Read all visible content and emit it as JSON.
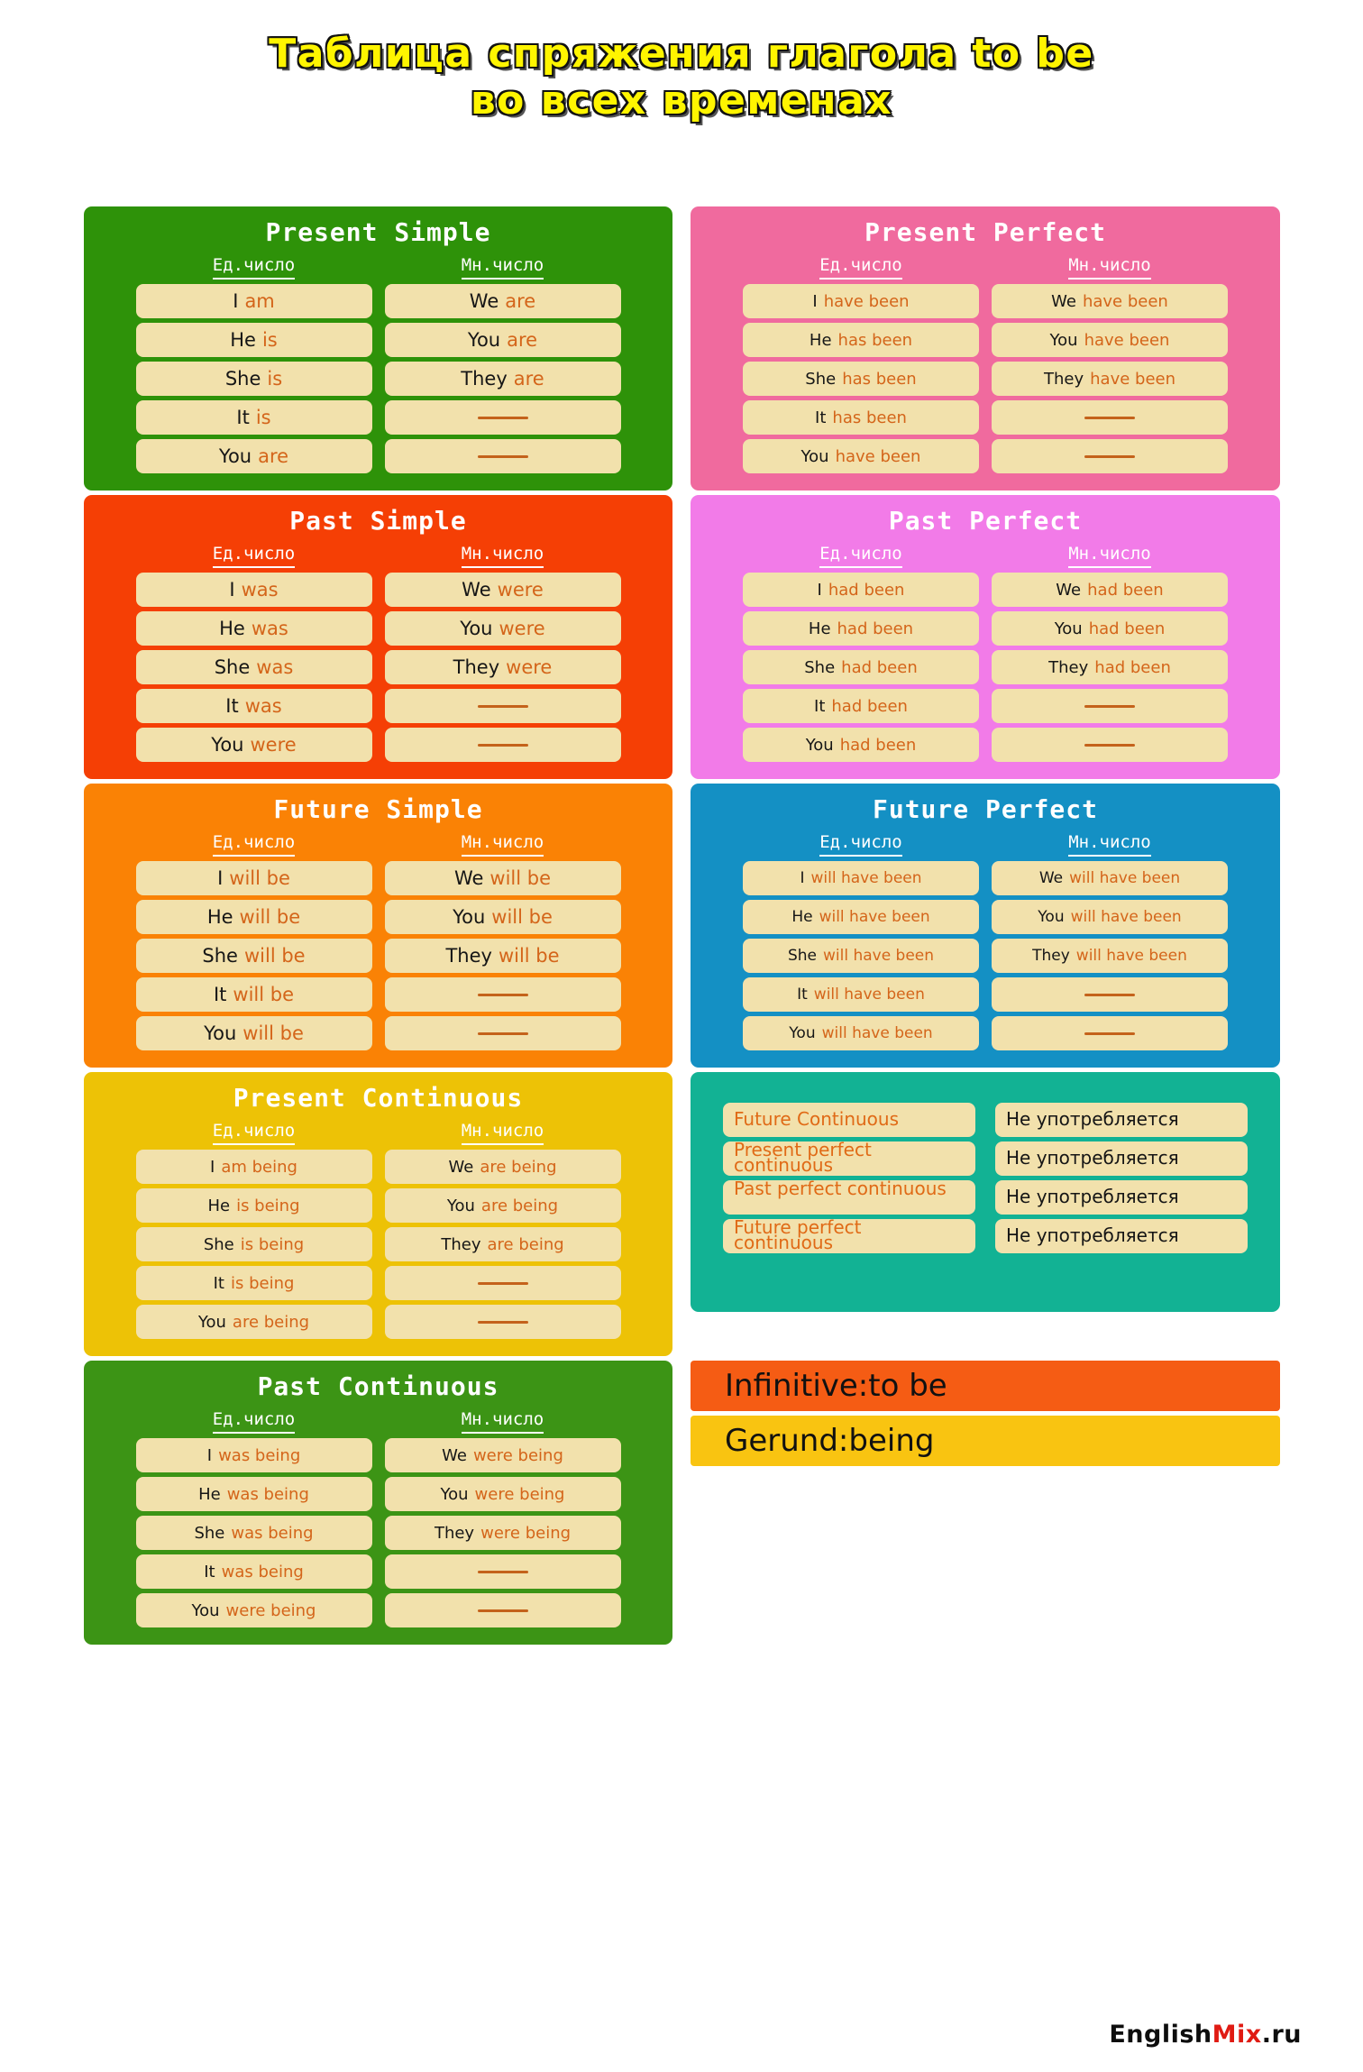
{
  "title": {
    "line1": "Таблица спряжения глагола to be",
    "line2": "во всех временах"
  },
  "labels": {
    "singular": "Ед.число",
    "plural": "Мн.число",
    "dash": "—"
  },
  "colors": {
    "present_simple": "#2E9209",
    "present_perfect": "#F06A9E",
    "past_simple": "#F53F05",
    "past_perfect": "#F27BE8",
    "future_simple": "#FA8205",
    "future_perfect": "#1490C4",
    "present_continuous": "#EDC206",
    "not_used": "#12B294",
    "past_continuous": "#3C9415",
    "infinitive_bar": "#F55C14",
    "gerund_bar": "#F9C411",
    "pill": "#F2E1AC",
    "pronoun_text": "#161616",
    "verb_text": "#D4651A",
    "title_fill": "#FFF500"
  },
  "cards": [
    {
      "name": "present-simple",
      "title": "Present Simple",
      "singular": [
        {
          "pron": "I",
          "verb": "am"
        },
        {
          "pron": "He",
          "verb": "is"
        },
        {
          "pron": "She",
          "verb": "is"
        },
        {
          "pron": "It",
          "verb": "is"
        },
        {
          "pron": "You",
          "verb": "are"
        }
      ],
      "plural": [
        {
          "pron": "We",
          "verb": "are"
        },
        {
          "pron": "You",
          "verb": "are"
        },
        {
          "pron": "They",
          "verb": "are"
        },
        {
          "pron": "",
          "verb": ""
        },
        {
          "pron": "",
          "verb": ""
        }
      ]
    },
    {
      "name": "present-perfect",
      "title": "Present Perfect",
      "singular": [
        {
          "pron": "I",
          "verb": "have been"
        },
        {
          "pron": "He",
          "verb": "has been"
        },
        {
          "pron": "She",
          "verb": "has been"
        },
        {
          "pron": "It",
          "verb": "has been"
        },
        {
          "pron": "You",
          "verb": "have been"
        }
      ],
      "plural": [
        {
          "pron": "We",
          "verb": "have been"
        },
        {
          "pron": "You",
          "verb": "have been"
        },
        {
          "pron": "They",
          "verb": "have been"
        },
        {
          "pron": "",
          "verb": ""
        },
        {
          "pron": "",
          "verb": ""
        }
      ]
    },
    {
      "name": "past-simple",
      "title": "Past Simple",
      "singular": [
        {
          "pron": "I",
          "verb": "was"
        },
        {
          "pron": "He",
          "verb": "was"
        },
        {
          "pron": "She",
          "verb": "was"
        },
        {
          "pron": "It",
          "verb": "was"
        },
        {
          "pron": "You",
          "verb": "were"
        }
      ],
      "plural": [
        {
          "pron": "We",
          "verb": "were"
        },
        {
          "pron": "You",
          "verb": "were"
        },
        {
          "pron": "They",
          "verb": "were"
        },
        {
          "pron": "",
          "verb": ""
        },
        {
          "pron": "",
          "verb": ""
        }
      ]
    },
    {
      "name": "past-perfect",
      "title": "Past Perfect",
      "singular": [
        {
          "pron": "I",
          "verb": "had been"
        },
        {
          "pron": "He",
          "verb": "had been"
        },
        {
          "pron": "She",
          "verb": "had been"
        },
        {
          "pron": "It",
          "verb": "had been"
        },
        {
          "pron": "You",
          "verb": "had been"
        }
      ],
      "plural": [
        {
          "pron": "We",
          "verb": "had been"
        },
        {
          "pron": "You",
          "verb": "had been"
        },
        {
          "pron": "They",
          "verb": "had been"
        },
        {
          "pron": "",
          "verb": ""
        },
        {
          "pron": "",
          "verb": ""
        }
      ]
    },
    {
      "name": "future-simple",
      "title": "Future Simple",
      "singular": [
        {
          "pron": "I",
          "verb": "will be"
        },
        {
          "pron": "He",
          "verb": "will be"
        },
        {
          "pron": "She",
          "verb": "will be"
        },
        {
          "pron": "It",
          "verb": "will be"
        },
        {
          "pron": "You",
          "verb": "will be"
        }
      ],
      "plural": [
        {
          "pron": "We",
          "verb": "will be"
        },
        {
          "pron": "You",
          "verb": "will be"
        },
        {
          "pron": "They",
          "verb": "will be"
        },
        {
          "pron": "",
          "verb": ""
        },
        {
          "pron": "",
          "verb": ""
        }
      ]
    },
    {
      "name": "future-perfect",
      "title": "Future Perfect",
      "singular": [
        {
          "pron": "I",
          "verb": "will have been"
        },
        {
          "pron": "He",
          "verb": "will have been"
        },
        {
          "pron": "She",
          "verb": "will have been"
        },
        {
          "pron": "It",
          "verb": "will have been"
        },
        {
          "pron": "You",
          "verb": "will have been"
        }
      ],
      "plural": [
        {
          "pron": "We",
          "verb": "will have been"
        },
        {
          "pron": "You",
          "verb": "will have been"
        },
        {
          "pron": "They",
          "verb": "will have been"
        },
        {
          "pron": "",
          "verb": ""
        },
        {
          "pron": "",
          "verb": ""
        }
      ]
    },
    {
      "name": "present-continuous",
      "title": "Present Continuous",
      "singular": [
        {
          "pron": "I",
          "verb": "am being"
        },
        {
          "pron": "He",
          "verb": "is being"
        },
        {
          "pron": "She",
          "verb": "is being"
        },
        {
          "pron": "It",
          "verb": "is being"
        },
        {
          "pron": "You",
          "verb": "are being"
        }
      ],
      "plural": [
        {
          "pron": "We",
          "verb": "are being"
        },
        {
          "pron": "You",
          "verb": "are being"
        },
        {
          "pron": "They",
          "verb": "are being"
        },
        {
          "pron": "",
          "verb": ""
        },
        {
          "pron": "",
          "verb": ""
        }
      ]
    },
    {
      "name": "past-continuous",
      "title": "Past Continuous",
      "singular": [
        {
          "pron": "I",
          "verb": "was being"
        },
        {
          "pron": "He",
          "verb": "was being"
        },
        {
          "pron": "She",
          "verb": "was being"
        },
        {
          "pron": "It",
          "verb": "was being"
        },
        {
          "pron": "You",
          "verb": "were being"
        }
      ],
      "plural": [
        {
          "pron": "We",
          "verb": "were being"
        },
        {
          "pron": "You",
          "verb": "were being"
        },
        {
          "pron": "They",
          "verb": "were being"
        },
        {
          "pron": "",
          "verb": ""
        },
        {
          "pron": "",
          "verb": ""
        }
      ]
    }
  ],
  "not_used": {
    "rows": [
      {
        "term": "Future Continuous",
        "message": "Не употребляется"
      },
      {
        "term": "Present perfect continuous",
        "message": "Не употребляется"
      },
      {
        "term": "Past perfect continuous",
        "message": "Не употребляется"
      },
      {
        "term": "Future perfect continuous",
        "message": "Не употребляется"
      }
    ]
  },
  "bars": {
    "infinitive": "Infinitive:to be",
    "gerund": "Gerund:being"
  },
  "footer": {
    "part1": "English",
    "part2": "Mix",
    "part3": ".ru"
  }
}
